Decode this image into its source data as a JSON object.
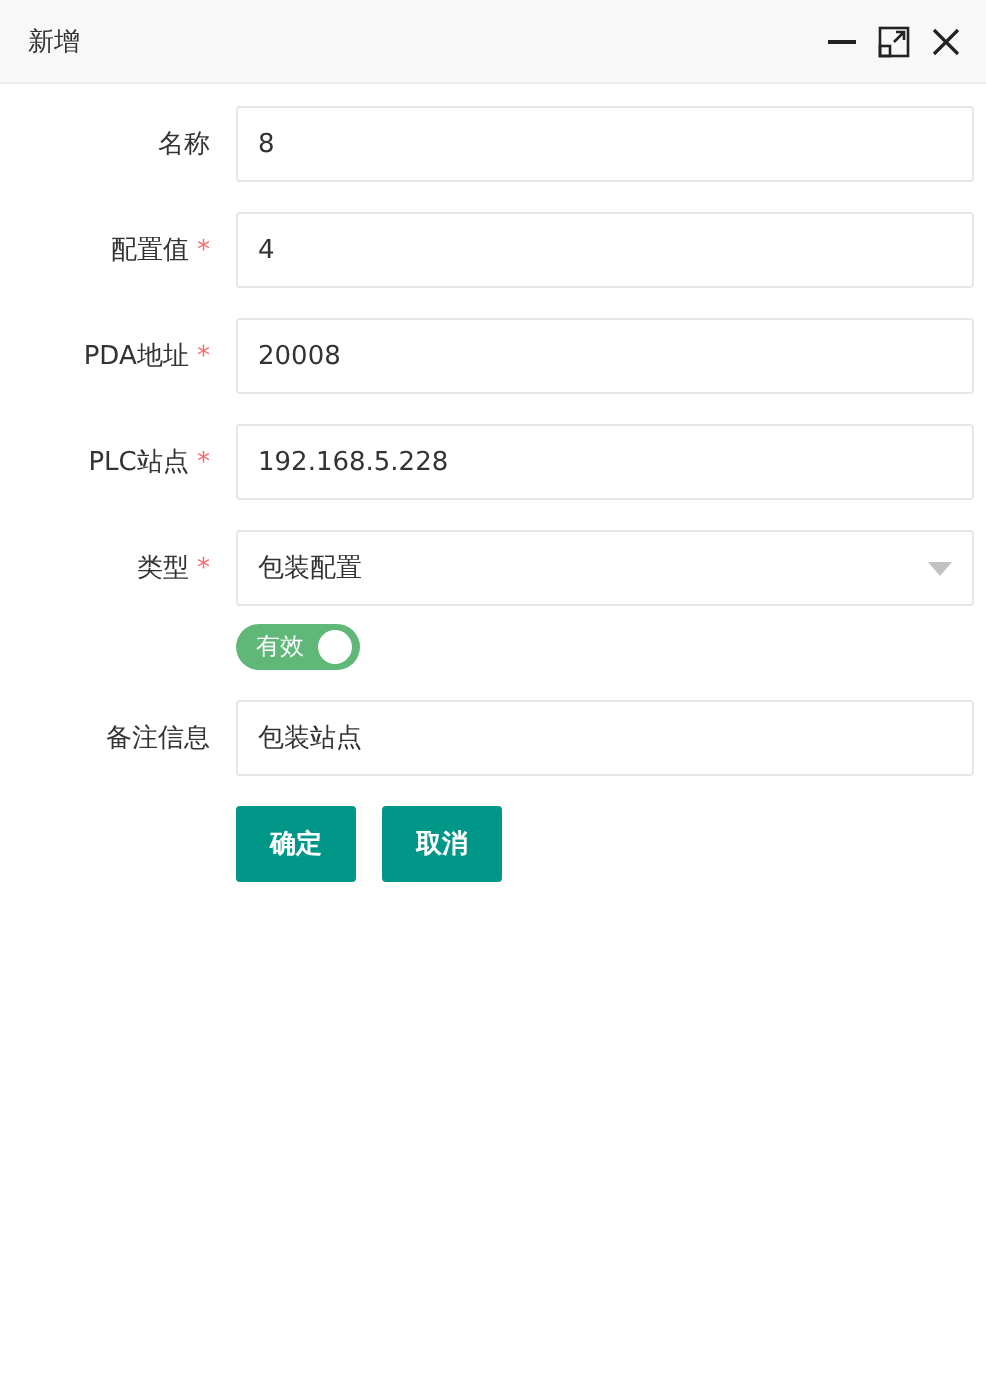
{
  "window": {
    "title": "新增"
  },
  "fields": [
    {
      "label": "名称",
      "required": false,
      "kind": "text",
      "value": "8"
    },
    {
      "label": "配置值",
      "required": true,
      "kind": "text",
      "value": "4"
    },
    {
      "label": "PDA地址",
      "required": true,
      "kind": "text",
      "value": "20008"
    },
    {
      "label": "PLC站点",
      "required": true,
      "kind": "text",
      "value": "192.168.5.228"
    },
    {
      "label": "类型",
      "required": true,
      "kind": "select",
      "value": "包装配置"
    },
    {
      "kind": "switch",
      "on": true,
      "text": "有效"
    },
    {
      "label": "备注信息",
      "required": false,
      "kind": "text",
      "value": "包装站点"
    }
  ],
  "required_mark": "*",
  "buttons": [
    "确定",
    "取消"
  ]
}
